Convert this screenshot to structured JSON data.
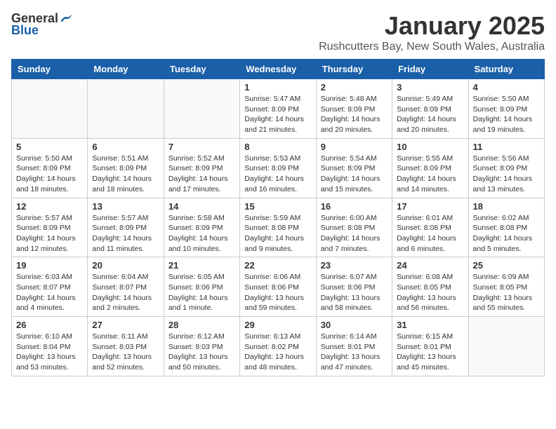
{
  "header": {
    "logo_general": "General",
    "logo_blue": "Blue",
    "month_title": "January 2025",
    "location": "Rushcutters Bay, New South Wales, Australia"
  },
  "days_of_week": [
    "Sunday",
    "Monday",
    "Tuesday",
    "Wednesday",
    "Thursday",
    "Friday",
    "Saturday"
  ],
  "weeks": [
    [
      {
        "day": "",
        "info": ""
      },
      {
        "day": "",
        "info": ""
      },
      {
        "day": "",
        "info": ""
      },
      {
        "day": "1",
        "info": "Sunrise: 5:47 AM\nSunset: 8:09 PM\nDaylight: 14 hours\nand 21 minutes."
      },
      {
        "day": "2",
        "info": "Sunrise: 5:48 AM\nSunset: 8:09 PM\nDaylight: 14 hours\nand 20 minutes."
      },
      {
        "day": "3",
        "info": "Sunrise: 5:49 AM\nSunset: 8:09 PM\nDaylight: 14 hours\nand 20 minutes."
      },
      {
        "day": "4",
        "info": "Sunrise: 5:50 AM\nSunset: 8:09 PM\nDaylight: 14 hours\nand 19 minutes."
      }
    ],
    [
      {
        "day": "5",
        "info": "Sunrise: 5:50 AM\nSunset: 8:09 PM\nDaylight: 14 hours\nand 18 minutes."
      },
      {
        "day": "6",
        "info": "Sunrise: 5:51 AM\nSunset: 8:09 PM\nDaylight: 14 hours\nand 18 minutes."
      },
      {
        "day": "7",
        "info": "Sunrise: 5:52 AM\nSunset: 8:09 PM\nDaylight: 14 hours\nand 17 minutes."
      },
      {
        "day": "8",
        "info": "Sunrise: 5:53 AM\nSunset: 8:09 PM\nDaylight: 14 hours\nand 16 minutes."
      },
      {
        "day": "9",
        "info": "Sunrise: 5:54 AM\nSunset: 8:09 PM\nDaylight: 14 hours\nand 15 minutes."
      },
      {
        "day": "10",
        "info": "Sunrise: 5:55 AM\nSunset: 8:09 PM\nDaylight: 14 hours\nand 14 minutes."
      },
      {
        "day": "11",
        "info": "Sunrise: 5:56 AM\nSunset: 8:09 PM\nDaylight: 14 hours\nand 13 minutes."
      }
    ],
    [
      {
        "day": "12",
        "info": "Sunrise: 5:57 AM\nSunset: 8:09 PM\nDaylight: 14 hours\nand 12 minutes."
      },
      {
        "day": "13",
        "info": "Sunrise: 5:57 AM\nSunset: 8:09 PM\nDaylight: 14 hours\nand 11 minutes."
      },
      {
        "day": "14",
        "info": "Sunrise: 5:58 AM\nSunset: 8:09 PM\nDaylight: 14 hours\nand 10 minutes."
      },
      {
        "day": "15",
        "info": "Sunrise: 5:59 AM\nSunset: 8:08 PM\nDaylight: 14 hours\nand 9 minutes."
      },
      {
        "day": "16",
        "info": "Sunrise: 6:00 AM\nSunset: 8:08 PM\nDaylight: 14 hours\nand 7 minutes."
      },
      {
        "day": "17",
        "info": "Sunrise: 6:01 AM\nSunset: 8:08 PM\nDaylight: 14 hours\nand 6 minutes."
      },
      {
        "day": "18",
        "info": "Sunrise: 6:02 AM\nSunset: 8:08 PM\nDaylight: 14 hours\nand 5 minutes."
      }
    ],
    [
      {
        "day": "19",
        "info": "Sunrise: 6:03 AM\nSunset: 8:07 PM\nDaylight: 14 hours\nand 4 minutes."
      },
      {
        "day": "20",
        "info": "Sunrise: 6:04 AM\nSunset: 8:07 PM\nDaylight: 14 hours\nand 2 minutes."
      },
      {
        "day": "21",
        "info": "Sunrise: 6:05 AM\nSunset: 8:06 PM\nDaylight: 14 hours\nand 1 minute."
      },
      {
        "day": "22",
        "info": "Sunrise: 6:06 AM\nSunset: 8:06 PM\nDaylight: 13 hours\nand 59 minutes."
      },
      {
        "day": "23",
        "info": "Sunrise: 6:07 AM\nSunset: 8:06 PM\nDaylight: 13 hours\nand 58 minutes."
      },
      {
        "day": "24",
        "info": "Sunrise: 6:08 AM\nSunset: 8:05 PM\nDaylight: 13 hours\nand 56 minutes."
      },
      {
        "day": "25",
        "info": "Sunrise: 6:09 AM\nSunset: 8:05 PM\nDaylight: 13 hours\nand 55 minutes."
      }
    ],
    [
      {
        "day": "26",
        "info": "Sunrise: 6:10 AM\nSunset: 8:04 PM\nDaylight: 13 hours\nand 53 minutes."
      },
      {
        "day": "27",
        "info": "Sunrise: 6:11 AM\nSunset: 8:03 PM\nDaylight: 13 hours\nand 52 minutes."
      },
      {
        "day": "28",
        "info": "Sunrise: 6:12 AM\nSunset: 8:03 PM\nDaylight: 13 hours\nand 50 minutes."
      },
      {
        "day": "29",
        "info": "Sunrise: 6:13 AM\nSunset: 8:02 PM\nDaylight: 13 hours\nand 48 minutes."
      },
      {
        "day": "30",
        "info": "Sunrise: 6:14 AM\nSunset: 8:01 PM\nDaylight: 13 hours\nand 47 minutes."
      },
      {
        "day": "31",
        "info": "Sunrise: 6:15 AM\nSunset: 8:01 PM\nDaylight: 13 hours\nand 45 minutes."
      },
      {
        "day": "",
        "info": ""
      }
    ]
  ]
}
